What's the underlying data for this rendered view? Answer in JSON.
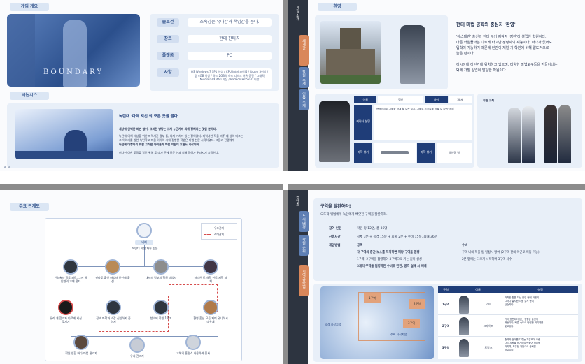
{
  "q1": {
    "section_label": "게임 개요",
    "synopsis_label": "시놉시스",
    "logo_text": "BOUNDARY",
    "info": [
      {
        "key": "슬로건",
        "value": "소속감은 유대감과 책임감을 준다."
      },
      {
        "key": "장르",
        "value": "현대 판타지"
      },
      {
        "key": "플랫폼",
        "value": "PC"
      },
      {
        "key": "사양",
        "value": "OS Windows 7 SP1 이상 / CPU Intel 코어i5 / Ryzen 3이상 / 램 4GB 이상 / 하드 2GB의 하드 디스크 여유 공간 / 그래픽 Nvidia GTX 460 이상 / Radeon HD5830 이상"
      }
    ],
    "synopsis_title": "녹턴대 '마력 저선'의 모든 곳을 물다",
    "synopsis_lines": [
      "세상에 완벽한 마번 없어, 그러한 방탕는 그저 누군가에 의해 정해지는 것일 뿐이다.",
      "녹턴에 의해 세상을 위난 마력셔진 정부 등, 외지 거처에 있는 정이었다. 마력셔한 적을 마주 네 살의 마포는",
      "고 이야기를 발한 녹턴학교 마음 아이의 시에 정형한 학생은 마법 본문 시작하였다. 그들과 전쟁에게",
      "녹턴에 대항하기 위한 그러한 아이들과 마법 학원이 오늘도 시작되어,",
      "허나한 아한 도정를 알긴 위해 로 대가 군계 모든 신과 의해 정해가 우녀지기 시작한다."
    ]
  },
  "q2": {
    "section_label": "환영",
    "sidebar_title": "게임 소개",
    "side_tabs": [
      "세계관",
      "학원 소개",
      "인물 소개"
    ],
    "heading": "현대 마법 공학의 중심지 '환영'",
    "paragraph_1": [
      "'에스테반' 출신의 현대 무기 제작자 '정찬'이 설립한 학원이다.",
      "다른 학원들과는 다르게 타고난 정령사의 재능이나, 마나가 없어도",
      "입학이 가능하기 때문에 인간이 제일 기 학원에 비해 압도적으로",
      "높은 편이다."
    ],
    "paragraph_2": [
      "아시아에 어딘가에 위치하고 있으며, 다양한 마법도구들을 만들어내는",
      "덕에 가장 상업이 발달한 학원이다."
    ],
    "char_table": {
      "head": [
        "이름",
        "정찬",
        "나이",
        "58세"
      ],
      "rows": [
        "캐릭터 설명",
        "마학 병기",
        "마학 병기"
      ],
      "desc": "'현재까지도 그들을 막게 할 수는 없지, 그들도 스스로를 막을 수 없어'라 해",
      "weapon_name": "마학 병기",
      "weapon_desc": "아이템 명"
    },
    "uniform_label": "학원 교복"
  },
  "q3": {
    "section_label": "주요 관계도",
    "legend": [
      "우호관계",
      "적대관계"
    ],
    "center_name": "나래",
    "nodes": [
      {
        "label": "녹턴대 학생\n자유 전문"
      },
      {
        "label": "인형술사\n학도 퍼트, 그에 빨\n인연의 교에 활자"
      },
      {
        "label": "판타로 출신 마법사\n인연에 출신"
      },
      {
        "label": "대서스\n정보의 학원 마법사"
      },
      {
        "label": "마라안\n로 실학 천로\n제학 파체"
      },
      {
        "label": "유리 계 참가자\n다르게 세실 무기기"
      },
      {
        "label": "정보 마학과 소장\n신인하지 중하지"
      },
      {
        "label": "청소에 학원 1학기"
      },
      {
        "label": "환영 출신 모든 재미\n유니하시 대우계"
      },
      {
        "label": "학원 연합\n바다 마법 관리자"
      },
      {
        "label": "유지 관리자"
      },
      {
        "label": "고해의 흥원소\n사용하여 흥사"
      }
    ]
  },
  "q4": {
    "sidebar_title": "컨텐츠",
    "side_tabs": [
      "도시 배경",
      "학원 순위",
      "지역 공략법"
    ],
    "heading": "구역을 탈환하라!",
    "intro": "오도각 위엄에게 녹턴에게 빼앗긴 구역을 탈환하라.",
    "rows": [
      {
        "key": "참여 인원",
        "value": "학원 당 12명, 총 36명"
      },
      {
        "key": "진행시간",
        "value": "정체 3분 + 공격 15분 + 회복 2분 + 수비 15분, 최대 36분"
      },
      {
        "key": "게임방법",
        "value": "공격"
      }
    ],
    "rules": [
      "각 구역의 중간 보스를 처치하면 해당 구역을 점령",
      "1구역, 2구역을 점령해야 3구역으로 가는 길이 생성",
      "3개의 구역을 점령하면 수비로 전환, 공격 실패 시 패배"
    ],
    "rules_right_title": "수비",
    "rules_right": [
      "구역 내의 적을 일 일정시 방어 (2구역 전의 아군로 이동 가능)",
      "2분 맵에는 다르게 시작하며 3구역 사수"
    ],
    "map_labels": [
      "1구역",
      "2구역",
      "3구역",
      "공격 시작지점",
      "수비 시작지점"
    ],
    "table_head": [
      "구역",
      "이름",
      "설명"
    ],
    "table_rows": [
      {
        "zone": "1구역",
        "name": "익트",
        "desc": "과학한 힘을 지닌 환영 현대 학원의\n그러나 흉지한 자를 갖게 형이\n단순하다."
      },
      {
        "zone": "2구역",
        "name": "그레이마",
        "desc": "커어 표편되어 있는 정형된 출신의\n애들이다, 빠른 속도로 난민한 거리제를\n갖고있다."
      },
      {
        "zone": "3구역",
        "name": "트랑포",
        "desc": "중력과 번개를 다루는 기갑조아 오랜\n다른 자원을 점거하여 만들어 재미를\n가지며, 보유한 자원으로 공략을\n하고있다."
      }
    ]
  }
}
